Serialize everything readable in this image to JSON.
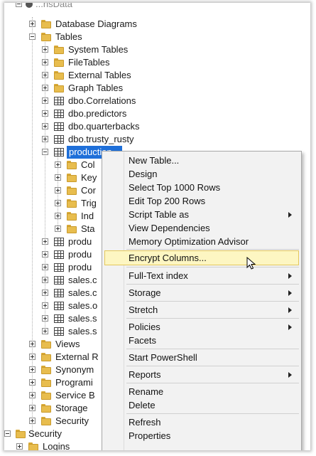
{
  "tree": {
    "root_partial": "...nsData",
    "items": [
      {
        "label": "Database Diagrams"
      },
      {
        "label": "Tables"
      },
      {
        "label": "System Tables"
      },
      {
        "label": "FileTables"
      },
      {
        "label": "External Tables"
      },
      {
        "label": "Graph Tables"
      },
      {
        "label": "dbo.Correlations"
      },
      {
        "label": "dbo.predictors"
      },
      {
        "label": "dbo.quarterbacks"
      },
      {
        "label": "dbo.trusty_rusty"
      },
      {
        "label": "production..."
      },
      {
        "label": "Col"
      },
      {
        "label": "Key"
      },
      {
        "label": "Cor"
      },
      {
        "label": "Trig"
      },
      {
        "label": "Ind"
      },
      {
        "label": "Sta"
      },
      {
        "label": "produ"
      },
      {
        "label": "produ"
      },
      {
        "label": "produ"
      },
      {
        "label": "sales.c"
      },
      {
        "label": "sales.c"
      },
      {
        "label": "sales.o"
      },
      {
        "label": "sales.s"
      },
      {
        "label": "sales.s"
      },
      {
        "label": "Views"
      },
      {
        "label": "External R"
      },
      {
        "label": "Synonym"
      },
      {
        "label": "Programi"
      },
      {
        "label": "Service B"
      },
      {
        "label": "Storage"
      },
      {
        "label": "Security"
      },
      {
        "label": "Security"
      },
      {
        "label": "Logins"
      }
    ]
  },
  "menu": {
    "items": [
      {
        "label": "New Table..."
      },
      {
        "label": "Design"
      },
      {
        "label": "Select Top 1000 Rows"
      },
      {
        "label": "Edit Top 200 Rows"
      },
      {
        "label": "Script Table as"
      },
      {
        "label": "View Dependencies"
      },
      {
        "label": "Memory Optimization Advisor"
      },
      {
        "label": "Encrypt Columns..."
      },
      {
        "label": "Full-Text index"
      },
      {
        "label": "Storage"
      },
      {
        "label": "Stretch"
      },
      {
        "label": "Policies"
      },
      {
        "label": "Facets"
      },
      {
        "label": "Start PowerShell"
      },
      {
        "label": "Reports"
      },
      {
        "label": "Rename"
      },
      {
        "label": "Delete"
      },
      {
        "label": "Refresh"
      },
      {
        "label": "Properties"
      }
    ]
  }
}
